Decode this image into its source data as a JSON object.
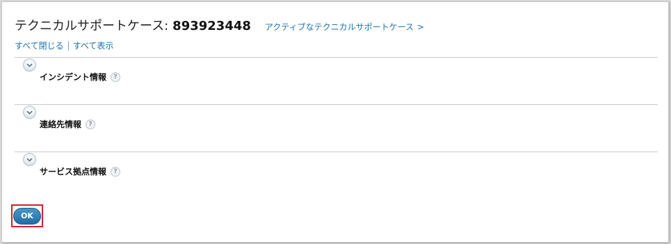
{
  "header": {
    "title": "テクニカルサポートケース:",
    "case_number": "893923448",
    "active_cases_link": "アクティブなテクニカルサポートケース",
    "active_cases_chevron": ">"
  },
  "toggles": {
    "collapse_all": "すべて閉じる",
    "show_all": "すべて表示"
  },
  "sections": [
    {
      "label": "インシデント情報",
      "help": "?"
    },
    {
      "label": "連絡先情報",
      "help": "?"
    },
    {
      "label": "サービス拠点情報",
      "help": "?"
    }
  ],
  "footer": {
    "ok_label": "OK"
  },
  "colors": {
    "link": "#1f6fa8",
    "highlight_border": "#d0202a",
    "ok_button": "#2a7db5"
  },
  "icons": {
    "expand": "chevron-down-icon",
    "help": "help-icon",
    "chevron_right": "chevron-right-icon"
  }
}
